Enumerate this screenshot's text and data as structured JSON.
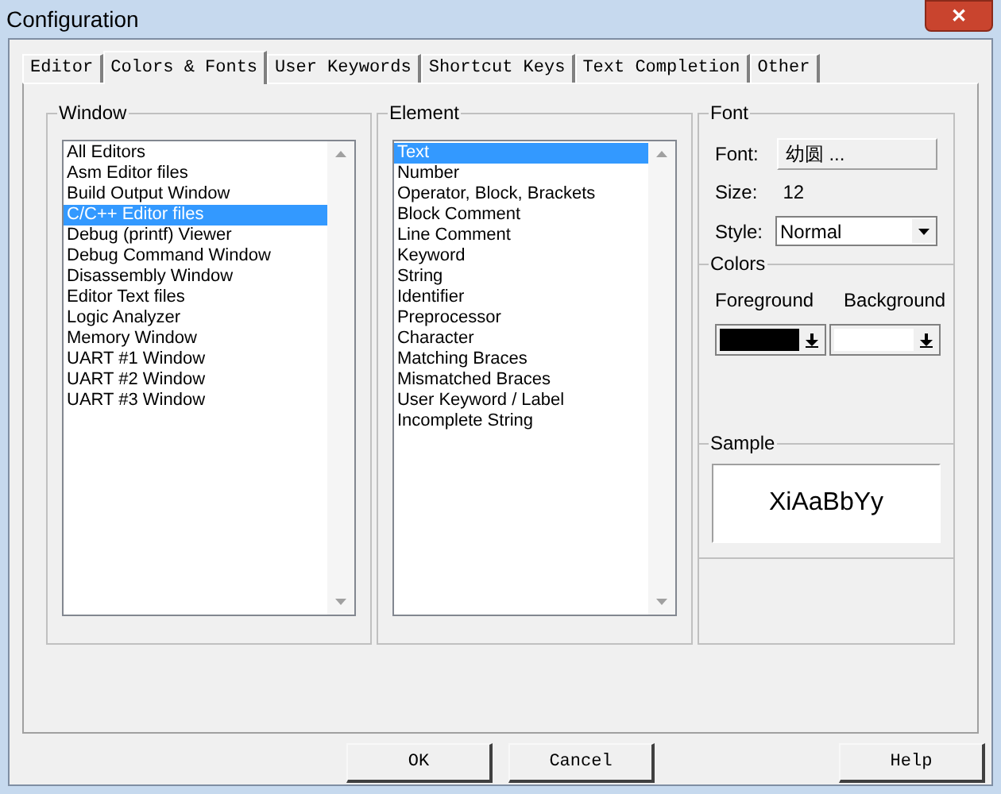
{
  "window": {
    "title": "Configuration",
    "close": "✕"
  },
  "tabs": [
    {
      "label": "Editor",
      "selected": false
    },
    {
      "label": "Colors & Fonts",
      "selected": true
    },
    {
      "label": "User Keywords",
      "selected": false
    },
    {
      "label": "Shortcut Keys",
      "selected": false
    },
    {
      "label": "Text Completion",
      "selected": false
    },
    {
      "label": "Other",
      "selected": false
    }
  ],
  "window_group": {
    "title": "Window",
    "items": [
      {
        "label": "All Editors",
        "selected": false
      },
      {
        "label": "Asm Editor files",
        "selected": false
      },
      {
        "label": "Build Output Window",
        "selected": false
      },
      {
        "label": "C/C++ Editor files",
        "selected": true
      },
      {
        "label": "Debug (printf) Viewer",
        "selected": false
      },
      {
        "label": "Debug Command Window",
        "selected": false
      },
      {
        "label": "Disassembly Window",
        "selected": false
      },
      {
        "label": "Editor Text files",
        "selected": false
      },
      {
        "label": "Logic Analyzer",
        "selected": false
      },
      {
        "label": "Memory Window",
        "selected": false
      },
      {
        "label": "UART #1 Window",
        "selected": false
      },
      {
        "label": "UART #2 Window",
        "selected": false
      },
      {
        "label": "UART #3 Window",
        "selected": false
      }
    ]
  },
  "element_group": {
    "title": "Element",
    "items": [
      {
        "label": "Text",
        "selected": true
      },
      {
        "label": "Number",
        "selected": false
      },
      {
        "label": "Operator, Block, Brackets",
        "selected": false
      },
      {
        "label": "Block Comment",
        "selected": false
      },
      {
        "label": "Line Comment",
        "selected": false
      },
      {
        "label": "Keyword",
        "selected": false
      },
      {
        "label": "String",
        "selected": false
      },
      {
        "label": "Identifier",
        "selected": false
      },
      {
        "label": "Preprocessor",
        "selected": false
      },
      {
        "label": "Character",
        "selected": false
      },
      {
        "label": "Matching Braces",
        "selected": false
      },
      {
        "label": "Mismatched Braces",
        "selected": false
      },
      {
        "label": "User Keyword / Label",
        "selected": false
      },
      {
        "label": "Incomplete String",
        "selected": false
      }
    ]
  },
  "font_group": {
    "title": "Font",
    "font_label": "Font:",
    "font_value": "幼圆 ...",
    "size_label": "Size:",
    "size_value": "12",
    "style_label": "Style:",
    "style_value": "Normal"
  },
  "colors_group": {
    "title": "Colors",
    "foreground_label": "Foreground",
    "background_label": "Background",
    "foreground": {
      "color": "#000000"
    },
    "background": {
      "color": "#ffffff"
    }
  },
  "sample_group": {
    "title": "Sample",
    "text": "XiAaBbYy"
  },
  "buttons": [
    "OK",
    "Cancel",
    "Help"
  ]
}
